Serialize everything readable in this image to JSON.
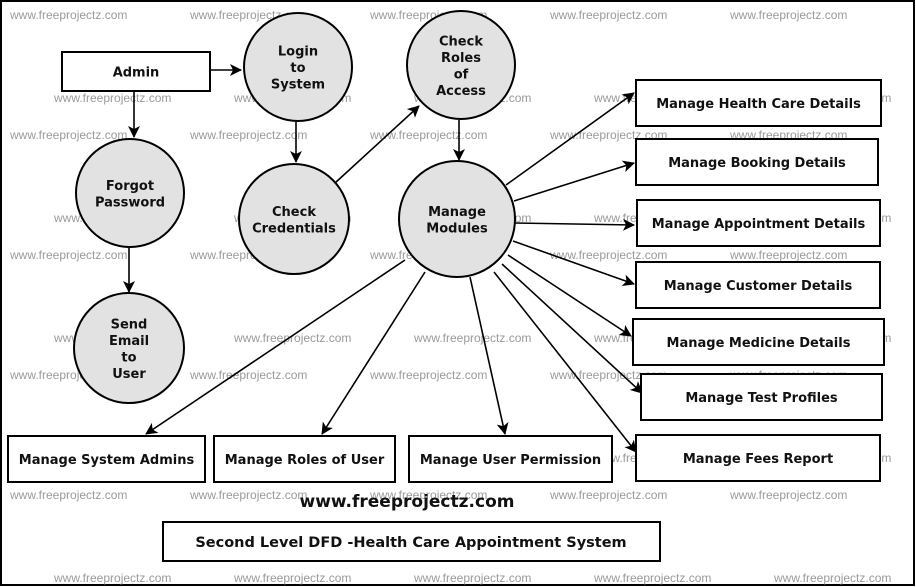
{
  "diagram": {
    "title": "Second Level DFD -Health Care Appointment System",
    "site_label": "www.freeprojectz.com",
    "watermark": "www.freeprojectz.com",
    "colors": {
      "process_fill": "#e2e2e2",
      "stroke": "#000000",
      "background": "#ffffff",
      "watermark": "#9a9a9a"
    },
    "entities": [
      {
        "id": "admin",
        "label": "Admin"
      }
    ],
    "processes": [
      {
        "id": "login",
        "lines": [
          "Login",
          "to",
          "System"
        ]
      },
      {
        "id": "check_roles",
        "lines": [
          "Check",
          "Roles",
          "of",
          "Access"
        ]
      },
      {
        "id": "forgot",
        "lines": [
          "Forgot",
          "Password"
        ]
      },
      {
        "id": "check_cred",
        "lines": [
          "Check",
          "Credentials"
        ]
      },
      {
        "id": "manage_modules",
        "lines": [
          "Manage",
          "Modules"
        ]
      },
      {
        "id": "send_email",
        "lines": [
          "Send",
          "Email",
          "to",
          "User"
        ]
      }
    ],
    "modules": [
      {
        "id": "m_health",
        "label": "Manage Health Care Details"
      },
      {
        "id": "m_booking",
        "label": "Manage Booking Details"
      },
      {
        "id": "m_appointment",
        "label": "Manage Appointment Details"
      },
      {
        "id": "m_customer",
        "label": "Manage Customer Details"
      },
      {
        "id": "m_medicine",
        "label": "Manage Medicine Details"
      },
      {
        "id": "m_test",
        "label": "Manage Test Profiles"
      },
      {
        "id": "m_fees",
        "label": "Manage Fees  Report"
      },
      {
        "id": "m_sysadmins",
        "label": "Manage System Admins"
      },
      {
        "id": "m_roles",
        "label": "Manage Roles of User"
      },
      {
        "id": "m_permission",
        "label": "Manage User Permission"
      }
    ],
    "flows": [
      {
        "from": "admin",
        "to": "login"
      },
      {
        "from": "admin",
        "to": "forgot"
      },
      {
        "from": "login",
        "to": "check_cred"
      },
      {
        "from": "check_cred",
        "to": "check_roles"
      },
      {
        "from": "check_roles",
        "to": "manage_modules"
      },
      {
        "from": "forgot",
        "to": "send_email"
      },
      {
        "from": "manage_modules",
        "to": "m_health"
      },
      {
        "from": "manage_modules",
        "to": "m_booking"
      },
      {
        "from": "manage_modules",
        "to": "m_appointment"
      },
      {
        "from": "manage_modules",
        "to": "m_customer"
      },
      {
        "from": "manage_modules",
        "to": "m_medicine"
      },
      {
        "from": "manage_modules",
        "to": "m_test"
      },
      {
        "from": "manage_modules",
        "to": "m_fees"
      },
      {
        "from": "manage_modules",
        "to": "m_sysadmins"
      },
      {
        "from": "manage_modules",
        "to": "m_roles"
      },
      {
        "from": "manage_modules",
        "to": "m_permission"
      }
    ]
  }
}
